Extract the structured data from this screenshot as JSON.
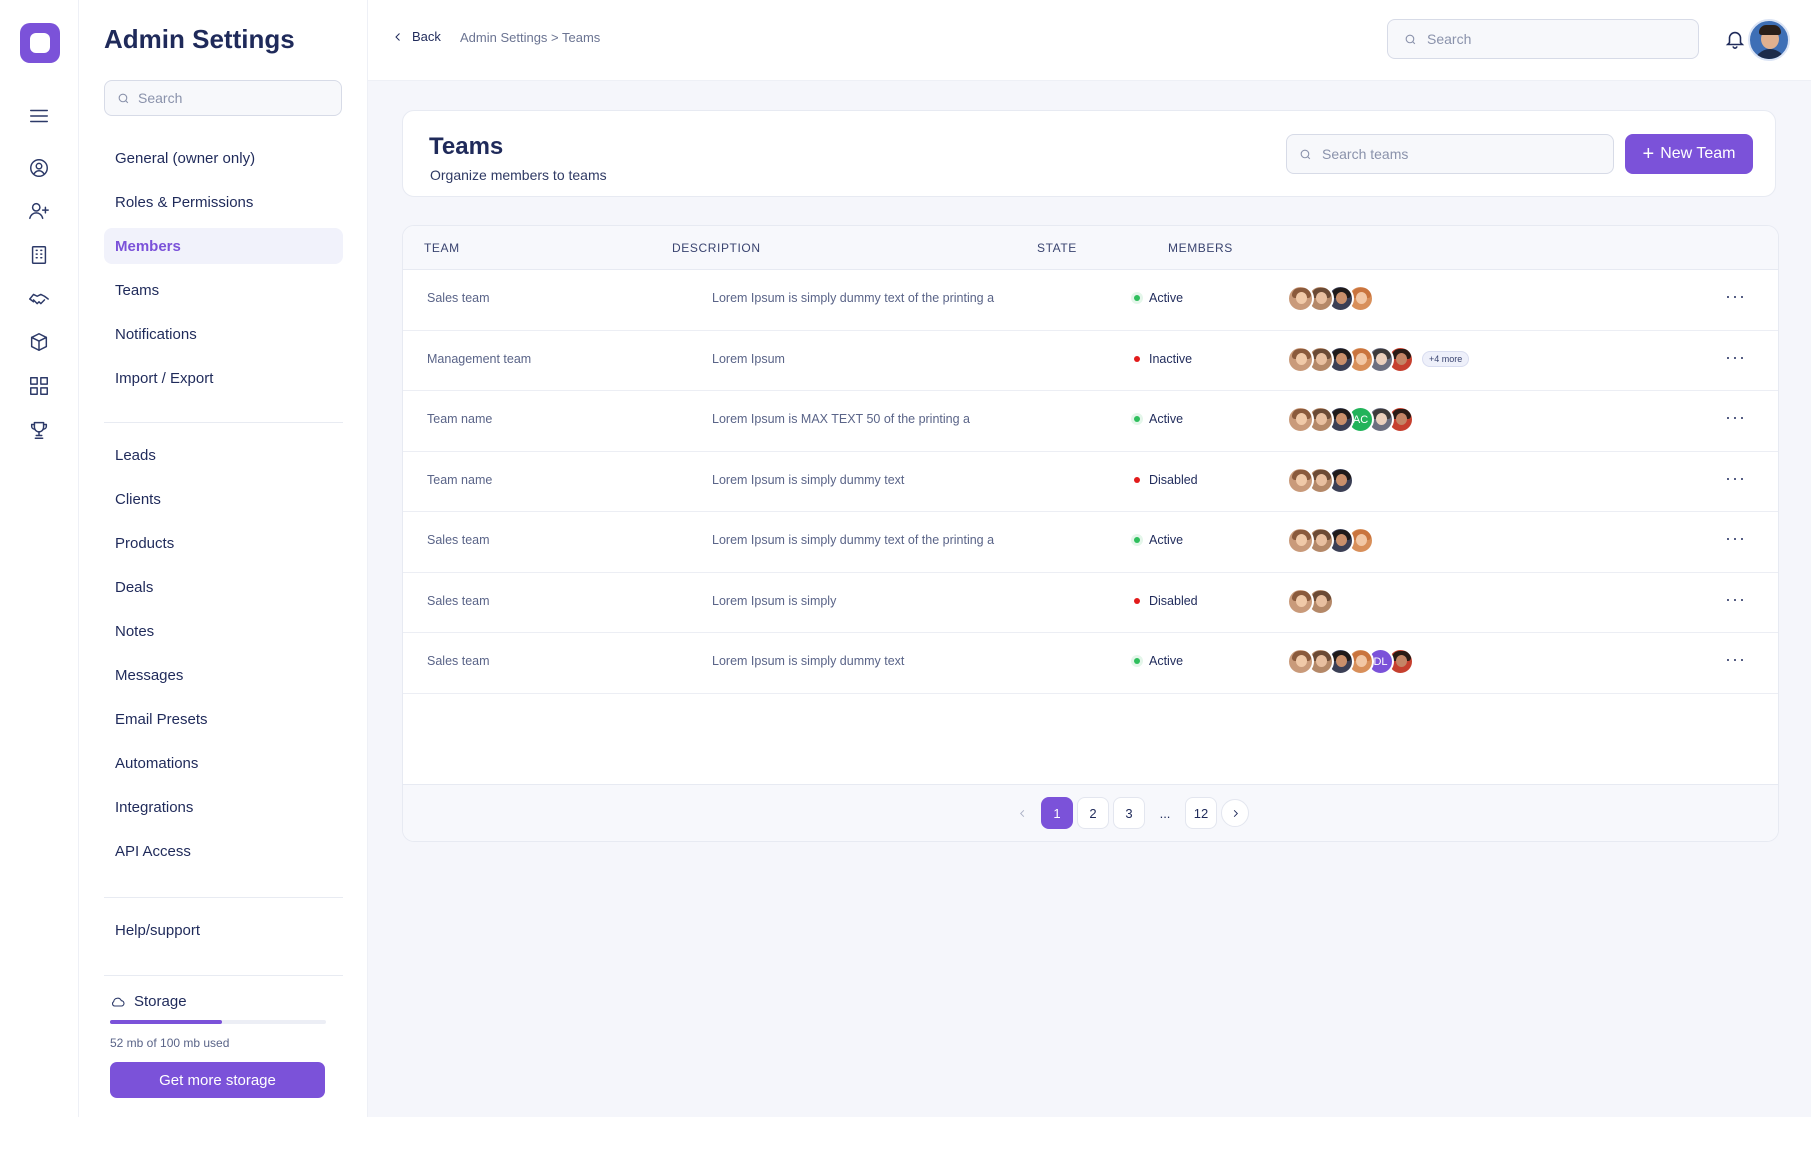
{
  "rail": {
    "icons": [
      "menu-icon",
      "user-circle-icon",
      "add-user-icon",
      "building-icon",
      "handshake-icon",
      "box-icon",
      "dashboard-grid-icon",
      "trophy-icon"
    ]
  },
  "sidebar": {
    "title": "Admin Settings",
    "search_placeholder": "Search",
    "group1": [
      {
        "label": "General (owner only)",
        "active": false
      },
      {
        "label": "Roles & Permissions",
        "active": false
      },
      {
        "label": "Members",
        "active": true
      },
      {
        "label": "Teams",
        "active": false
      },
      {
        "label": "Notifications",
        "active": false
      },
      {
        "label": "Import / Export",
        "active": false
      }
    ],
    "group2": [
      {
        "label": "Leads"
      },
      {
        "label": "Clients"
      },
      {
        "label": "Products"
      },
      {
        "label": "Deals"
      },
      {
        "label": "Notes"
      },
      {
        "label": "Messages"
      },
      {
        "label": "Email Presets"
      },
      {
        "label": "Automations"
      },
      {
        "label": "Integrations"
      },
      {
        "label": "API Access"
      }
    ],
    "group3": [
      {
        "label": "Help/support"
      }
    ],
    "storage": {
      "label": "Storage",
      "usage_text": "52 mb of 100 mb used",
      "used_fraction": 0.52,
      "button_label": "Get more storage"
    }
  },
  "topbar": {
    "back_label": "Back",
    "breadcrumb": "Admin Settings > Teams",
    "search_placeholder": "Search"
  },
  "header": {
    "title": "Teams",
    "subtitle": "Organize members to teams",
    "search_placeholder": "Search teams",
    "new_team_label": "New Team"
  },
  "table": {
    "columns": [
      "TEAM",
      "DESCRIPTION",
      "STATE",
      "MEMBERS"
    ],
    "rows": [
      {
        "team": "Sales team",
        "description": "Lorem Ipsum is simply dummy text of the printing a",
        "state": "Active",
        "status": "green",
        "members": [
          {
            "type": "photo",
            "skin": "#f0c9a8",
            "hair": "#8a5a3c",
            "bg": "#c99a7a"
          },
          {
            "type": "photo",
            "skin": "#e8bfa0",
            "hair": "#6b4a35",
            "bg": "#b48868"
          },
          {
            "type": "photo",
            "skin": "#c98f6b",
            "hair": "#1f1a1a",
            "bg": "#3b3f55"
          },
          {
            "type": "photo",
            "skin": "#f2c7a5",
            "hair": "#c9743e",
            "bg": "#d88f5a"
          }
        ],
        "more": ""
      },
      {
        "team": "Management team",
        "description": "Lorem Ipsum",
        "state": "Inactive",
        "status": "red",
        "members": [
          {
            "type": "photo",
            "skin": "#f0c9a8",
            "hair": "#8a5a3c",
            "bg": "#c99a7a"
          },
          {
            "type": "photo",
            "skin": "#e8bfa0",
            "hair": "#6b4a35",
            "bg": "#b48868"
          },
          {
            "type": "photo",
            "skin": "#c98f6b",
            "hair": "#1f1a1a",
            "bg": "#3b3f55"
          },
          {
            "type": "photo",
            "skin": "#f2c7a5",
            "hair": "#c9743e",
            "bg": "#d88f5a"
          },
          {
            "type": "photo",
            "skin": "#ead0bd",
            "hair": "#3d3a3a",
            "bg": "#6c6f80"
          },
          {
            "type": "photo",
            "skin": "#c48566",
            "hair": "#2a1b15",
            "bg": "#c6402f"
          }
        ],
        "more": "+4 more"
      },
      {
        "team": "Team name",
        "description": "Lorem Ipsum is MAX TEXT 50 of the printing a",
        "state": "Active",
        "status": "green",
        "members": [
          {
            "type": "photo",
            "skin": "#f0c9a8",
            "hair": "#8a5a3c",
            "bg": "#c99a7a"
          },
          {
            "type": "photo",
            "skin": "#e8bfa0",
            "hair": "#6b4a35",
            "bg": "#b48868"
          },
          {
            "type": "photo",
            "skin": "#c98f6b",
            "hair": "#1f1a1a",
            "bg": "#3b3f55"
          },
          {
            "type": "initials",
            "text": "AC",
            "bg": "#22b35a"
          },
          {
            "type": "photo",
            "skin": "#ead0bd",
            "hair": "#3d3a3a",
            "bg": "#6c6f80"
          },
          {
            "type": "photo",
            "skin": "#c48566",
            "hair": "#2a1b15",
            "bg": "#c6402f"
          }
        ],
        "more": ""
      },
      {
        "team": "Team name",
        "description": "Lorem Ipsum is simply dummy text",
        "state": "Disabled",
        "status": "red",
        "members": [
          {
            "type": "photo",
            "skin": "#f0c9a8",
            "hair": "#8a5a3c",
            "bg": "#c99a7a"
          },
          {
            "type": "photo",
            "skin": "#e8bfa0",
            "hair": "#6b4a35",
            "bg": "#b48868"
          },
          {
            "type": "photo",
            "skin": "#c98f6b",
            "hair": "#1f1a1a",
            "bg": "#3b3f55"
          }
        ],
        "more": ""
      },
      {
        "team": "Sales team",
        "description": "Lorem Ipsum is simply dummy text of the printing a",
        "state": "Active",
        "status": "green",
        "members": [
          {
            "type": "photo",
            "skin": "#f0c9a8",
            "hair": "#8a5a3c",
            "bg": "#c99a7a"
          },
          {
            "type": "photo",
            "skin": "#e8bfa0",
            "hair": "#6b4a35",
            "bg": "#b48868"
          },
          {
            "type": "photo",
            "skin": "#c98f6b",
            "hair": "#1f1a1a",
            "bg": "#3b3f55"
          },
          {
            "type": "photo",
            "skin": "#f2c7a5",
            "hair": "#c9743e",
            "bg": "#d88f5a"
          }
        ],
        "more": ""
      },
      {
        "team": "Sales team",
        "description": "Lorem Ipsum is simply",
        "state": "Disabled",
        "status": "red",
        "members": [
          {
            "type": "photo",
            "skin": "#f0c9a8",
            "hair": "#8a5a3c",
            "bg": "#c99a7a"
          },
          {
            "type": "photo",
            "skin": "#e8bfa0",
            "hair": "#6b4a35",
            "bg": "#b48868"
          }
        ],
        "more": ""
      },
      {
        "team": "Sales team",
        "description": "Lorem Ipsum is simply dummy text",
        "state": "Active",
        "status": "green",
        "members": [
          {
            "type": "photo",
            "skin": "#f0c9a8",
            "hair": "#8a5a3c",
            "bg": "#c99a7a"
          },
          {
            "type": "photo",
            "skin": "#e8bfa0",
            "hair": "#6b4a35",
            "bg": "#b48868"
          },
          {
            "type": "photo",
            "skin": "#c98f6b",
            "hair": "#1f1a1a",
            "bg": "#3b3f55"
          },
          {
            "type": "photo",
            "skin": "#f2c7a5",
            "hair": "#c9743e",
            "bg": "#d88f5a"
          },
          {
            "type": "initials",
            "text": "DL",
            "bg": "#7b52d9"
          },
          {
            "type": "photo",
            "skin": "#c48566",
            "hair": "#2a1b15",
            "bg": "#c6402f"
          }
        ],
        "more": ""
      }
    ]
  },
  "pagination": {
    "pages": [
      "1",
      "2",
      "3",
      "...",
      "12"
    ],
    "current": "1"
  },
  "colors": {
    "accent": "#7b52d9",
    "active_dot": "#2fbf5d",
    "inactive_dot": "#e21b1b",
    "text_primary": "#1f2a5a"
  }
}
